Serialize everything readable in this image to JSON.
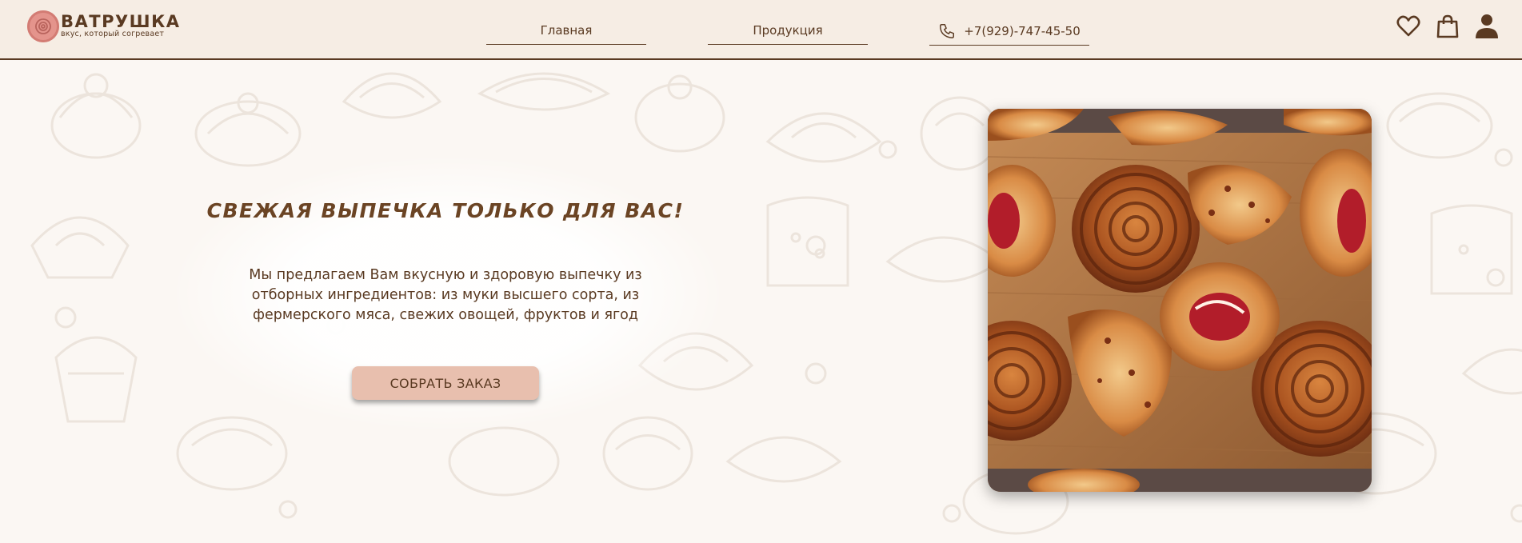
{
  "brand": {
    "name": "ВАТРУШКА",
    "tagline": "вкус, который согревает"
  },
  "nav": {
    "home": "Главная",
    "products": "Продукция",
    "phone": "+7(929)-747-45-50"
  },
  "header_icons": [
    "heart-icon",
    "shopping-bag-icon",
    "user-icon"
  ],
  "hero": {
    "title": "СВЕЖАЯ ВЫПЕЧКА ТОЛЬКО ДЛЯ ВАС!",
    "text": "Мы предлагаем Вам вкусную и здоровую выпечку из отборных ингредиентов: из муки высшего сорта, из фермерского мяса, свежих овощей, фруктов и ягод",
    "button": "СОБРАТЬ ЗАКАЗ"
  },
  "colors": {
    "header_bg": "#f6ede4",
    "page_bg": "#fbf7f3",
    "brown": "#5a3a22",
    "button_bg": "#e8bfae",
    "logo_pink": "#e4948c"
  }
}
